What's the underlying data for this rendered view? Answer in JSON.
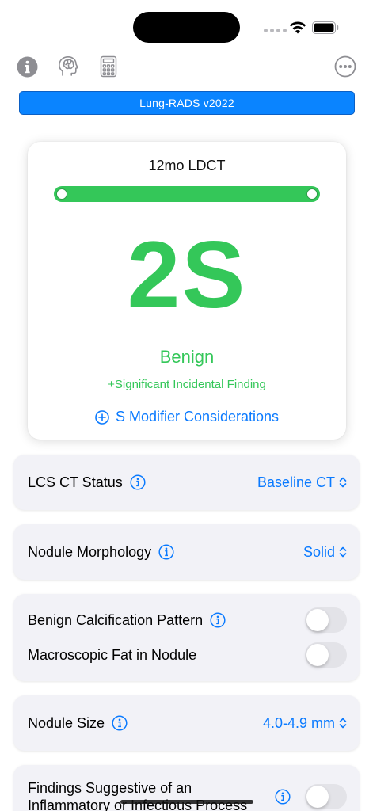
{
  "app": {
    "version_label": "Lung-RADS v2022"
  },
  "result": {
    "followup": "12mo LDCT",
    "category": "2S",
    "descriptor": "Benign",
    "modifier": "+Significant Incidental Finding",
    "s_modifier_link": "S Modifier Considerations",
    "accent_color": "#34c759"
  },
  "settings": {
    "ct_status": {
      "label": "LCS CT Status",
      "value": "Baseline CT"
    },
    "morphology": {
      "label": "Nodule Morphology",
      "value": "Solid"
    },
    "calcification": {
      "label": "Benign Calcification Pattern",
      "enabled": false
    },
    "macro_fat": {
      "label": "Macroscopic Fat in Nodule",
      "enabled": false
    },
    "nodule_size": {
      "label": "Nodule Size",
      "value": "4.0-4.9 mm"
    },
    "inflammatory": {
      "label_line1": "Findings Suggestive of an",
      "label_line2": "Inflammatory or Infectious Process",
      "enabled": false
    }
  },
  "icons": {
    "toolbar": [
      "info-icon",
      "brain-icon",
      "calculator-icon",
      "more-icon"
    ],
    "status": [
      "wifi-icon",
      "battery-icon"
    ]
  },
  "colors": {
    "link": "#0a7aff",
    "version_bar": "#0a84ff"
  }
}
